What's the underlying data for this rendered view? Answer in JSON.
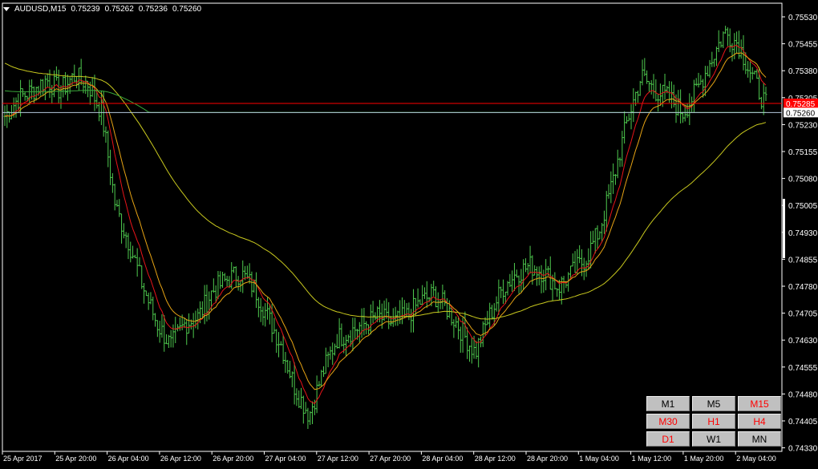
{
  "header": {
    "symbol": "AUDUSD,M15",
    "open": "0.75239",
    "high": "0.75262",
    "low": "0.75236",
    "close": "0.75260"
  },
  "price_axis": {
    "labels": [
      "0.75530",
      "0.75455",
      "0.75380",
      "0.75305",
      "0.75230",
      "0.75155",
      "0.75080",
      "0.75005",
      "0.74930",
      "0.74855",
      "0.74780",
      "0.74705",
      "0.74630",
      "0.74555",
      "0.74480",
      "0.74405",
      "0.74330"
    ],
    "red_line_label": "0.75285",
    "current_price_label": "0.75260"
  },
  "time_axis": {
    "labels": [
      "25 Apr 2017",
      "25 Apr 20:00",
      "26 Apr 04:00",
      "26 Apr 12:00",
      "26 Apr 20:00",
      "27 Apr 04:00",
      "27 Apr 12:00",
      "27 Apr 20:00",
      "28 Apr 04:00",
      "28 Apr 12:00",
      "28 Apr 20:00",
      "1 May 04:00",
      "1 May 12:00",
      "1 May 20:00",
      "2 May 04:00"
    ]
  },
  "timeframes": [
    {
      "label": "M1",
      "color": "#000000"
    },
    {
      "label": "M5",
      "color": "#000000"
    },
    {
      "label": "M15",
      "color": "#ff0000"
    },
    {
      "label": "M30",
      "color": "#ff0000"
    },
    {
      "label": "H1",
      "color": "#ff0000"
    },
    {
      "label": "H4",
      "color": "#ff0000"
    },
    {
      "label": "D1",
      "color": "#ff0000"
    },
    {
      "label": "W1",
      "color": "#000000"
    },
    {
      "label": "MN",
      "color": "#000000"
    }
  ],
  "colors": {
    "background": "#000000",
    "bars": "#4ec94e",
    "ma_fast": "#e8141a",
    "ma_mid": "#e6a314",
    "ma_slow": "#c8c81e",
    "ma_long_green": "#3aa83a",
    "red_level": "#ff0000",
    "current_level": "#b4c8dc",
    "axis_text": "#ffffff"
  },
  "chart_data": {
    "type": "line",
    "title": "AUDUSD,M15",
    "ylim": [
      0.7433,
      0.7556
    ],
    "x_ticks": [
      "25 Apr 2017",
      "25 Apr 20:00",
      "26 Apr 04:00",
      "26 Apr 12:00",
      "26 Apr 20:00",
      "27 Apr 04:00",
      "27 Apr 12:00",
      "27 Apr 20:00",
      "28 Apr 04:00",
      "28 Apr 12:00",
      "28 Apr 20:00",
      "1 May 04:00",
      "1 May 12:00",
      "1 May 20:00",
      "2 May 04:00"
    ],
    "price_path": [
      0.7525,
      0.753,
      0.7532,
      0.7535,
      0.7532,
      0.7536,
      0.7534,
      0.7526,
      0.75,
      0.749,
      0.7478,
      0.7468,
      0.7462,
      0.7468,
      0.747,
      0.7477,
      0.748,
      0.7482,
      0.7478,
      0.747,
      0.7462,
      0.745,
      0.7443,
      0.7455,
      0.7464,
      0.7466,
      0.7468,
      0.747,
      0.7468,
      0.747,
      0.7474,
      0.7476,
      0.7472,
      0.7466,
      0.746,
      0.747,
      0.7478,
      0.7482,
      0.7484,
      0.7482,
      0.7478,
      0.7482,
      0.7486,
      0.7494,
      0.7508,
      0.7524,
      0.7536,
      0.7532,
      0.753,
      0.7526,
      0.7532,
      0.754,
      0.7548,
      0.7545,
      0.7536,
      0.7528
    ],
    "red_level": 0.75285,
    "current_price": 0.7526
  }
}
